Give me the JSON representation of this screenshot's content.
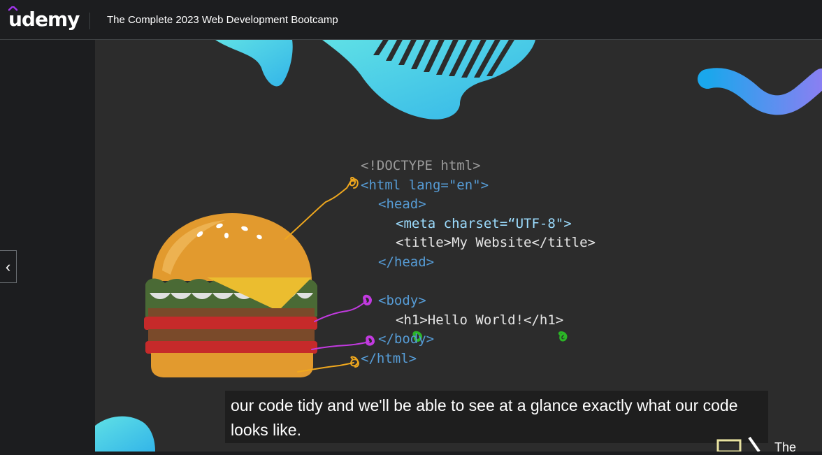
{
  "brand": {
    "logo_text": "udemy",
    "accent": "#a435f0"
  },
  "header": {
    "course_title": "The Complete 2023 Web Development Bootcamp"
  },
  "nav": {
    "prev_icon": "chevron-left-icon",
    "prev_glyph": "‹"
  },
  "code_lines": [
    "<!DOCTYPE html>",
    "<html lang=\"en\">",
    "<head>",
    "<meta charset=“UTF-8\">",
    "<title>My Website</title>",
    "</head>",
    "<body>",
    "<h1>Hello World!</h1>",
    "</body>",
    "</html>"
  ],
  "caption": {
    "text": "our code tidy and we'll be able to see at a glance exactly what our code looks like."
  },
  "corner_text": "The",
  "colors": {
    "tag": "#569cd6",
    "attr": "#9cdcfe",
    "string": "#ce9178",
    "bun": "#e29a2e",
    "lettuce": "#4a6a35",
    "tomato": "#c62a2a",
    "cheese": "#ebbd2f",
    "annot_yellow": "#f0a81e",
    "annot_purple": "#c23ae0",
    "annot_green": "#2bb526"
  }
}
